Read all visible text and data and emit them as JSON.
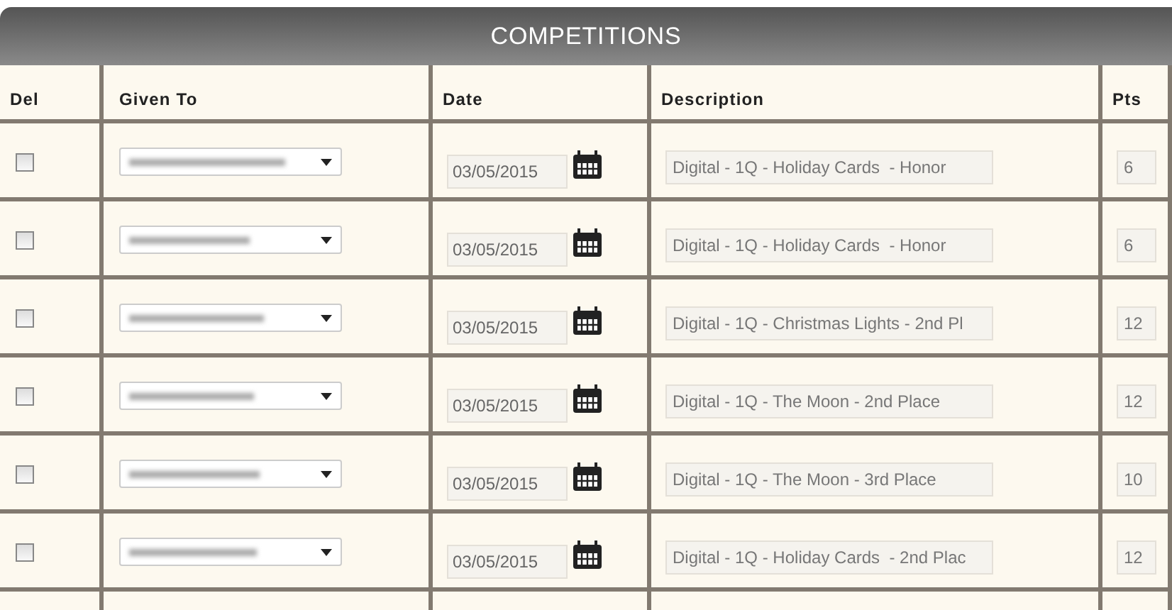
{
  "title": "COMPETITIONS",
  "columns": [
    "Del",
    "Given To",
    "Date",
    "Description",
    "Pts"
  ],
  "rows": [
    {
      "del_checked": false,
      "date": "03/05/2015",
      "description": "Digital - 1Q - Holiday Cards  - Honor",
      "pts": "6"
    },
    {
      "del_checked": false,
      "date": "03/05/2015",
      "description": "Digital - 1Q - Holiday Cards  - Honor",
      "pts": "6"
    },
    {
      "del_checked": false,
      "date": "03/05/2015",
      "description": "Digital - 1Q - Christmas Lights - 2nd Pl",
      "pts": "12"
    },
    {
      "del_checked": false,
      "date": "03/05/2015",
      "description": "Digital - 1Q - The Moon - 2nd Place",
      "pts": "12"
    },
    {
      "del_checked": false,
      "date": "03/05/2015",
      "description": "Digital - 1Q - The Moon - 3rd Place",
      "pts": "10"
    },
    {
      "del_checked": false,
      "date": "03/05/2015",
      "description": "Digital - 1Q - Holiday Cards  - 2nd Plac",
      "pts": "12"
    }
  ]
}
